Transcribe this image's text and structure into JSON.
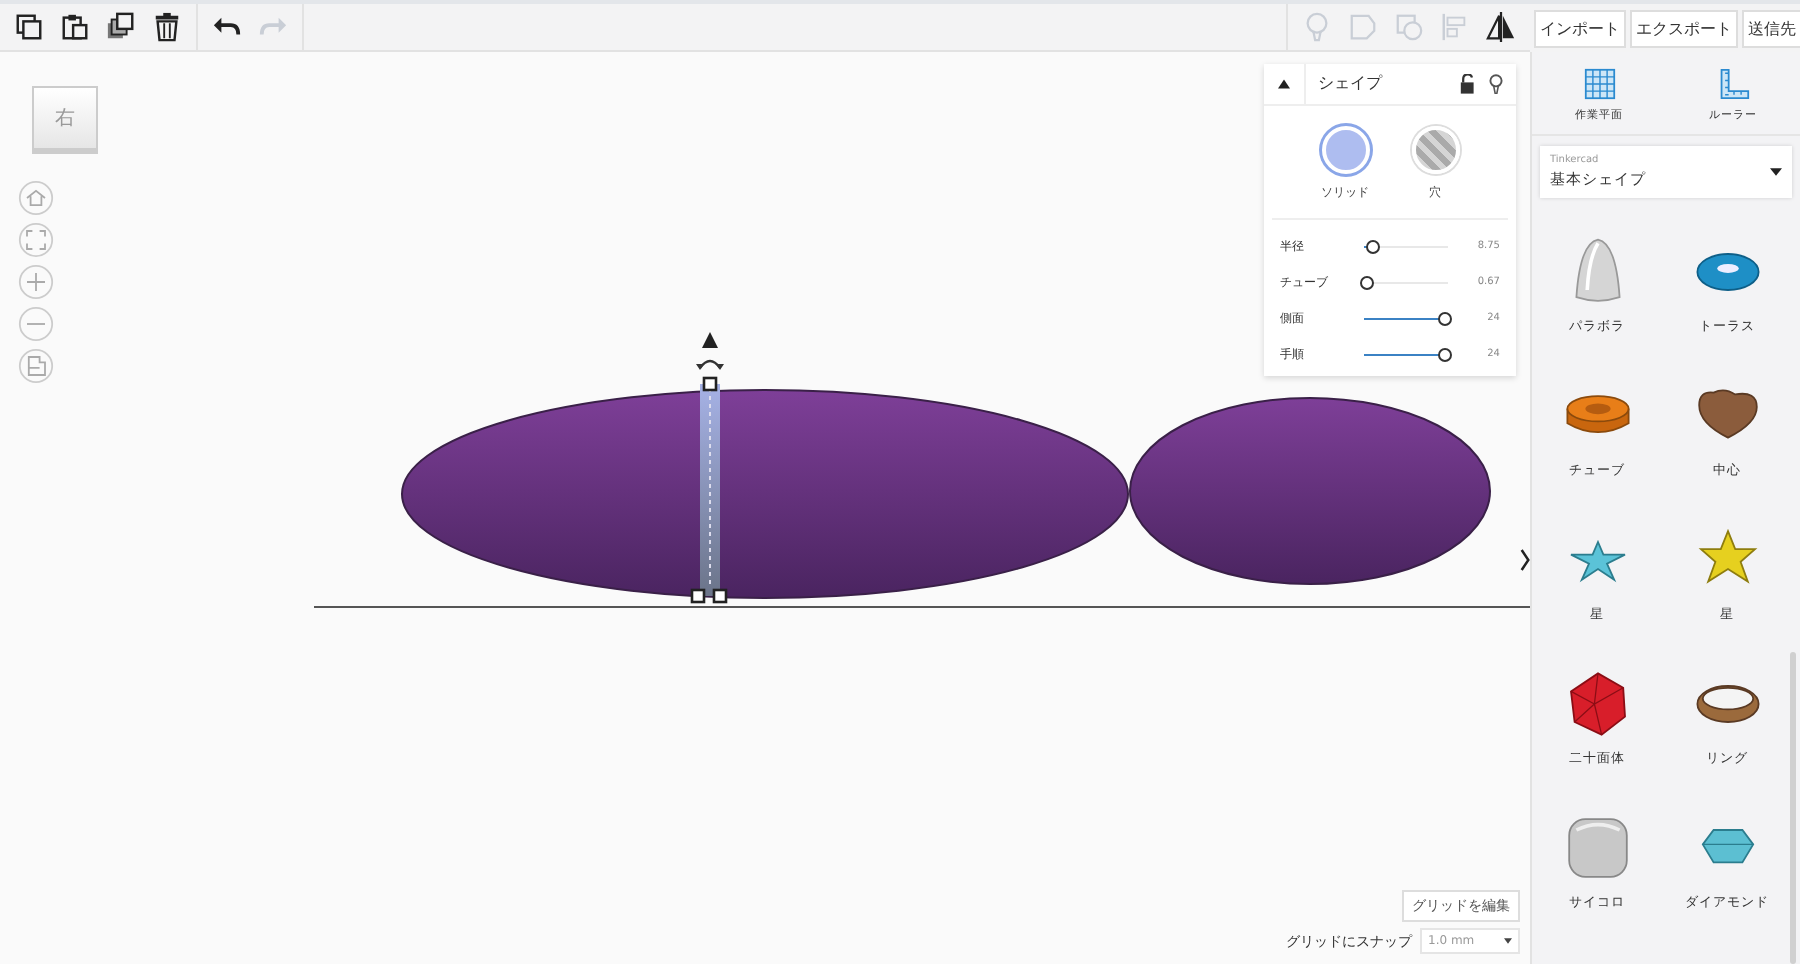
{
  "toolbar": {
    "edit_tools": [
      {
        "kind": "copy",
        "disabled": false
      },
      {
        "kind": "paste",
        "disabled": false
      },
      {
        "kind": "duplicate",
        "disabled": false
      },
      {
        "kind": "delete",
        "disabled": false
      }
    ],
    "history_tools": [
      {
        "kind": "undo",
        "disabled": false
      },
      {
        "kind": "redo",
        "disabled": true
      }
    ],
    "object_tools": [
      {
        "kind": "bulb",
        "disabled": true
      },
      {
        "kind": "group",
        "disabled": true
      },
      {
        "kind": "ungroup",
        "disabled": true
      },
      {
        "kind": "align",
        "disabled": true
      },
      {
        "kind": "mirror",
        "disabled": false
      }
    ]
  },
  "header_buttons": [
    "インポート",
    "エクスポート",
    "送信先"
  ],
  "view_cube": {
    "face": "右"
  },
  "view_controls": [
    {
      "kind": "home"
    },
    {
      "kind": "fit"
    },
    {
      "kind": "zoom-in"
    },
    {
      "kind": "zoom-out"
    },
    {
      "kind": "ortho"
    }
  ],
  "shape_panel": {
    "title": "シェイプ",
    "expanded": true,
    "modes": [
      {
        "label": "ソリッド",
        "kind": "solid",
        "selected": true
      },
      {
        "label": "穴",
        "kind": "hole",
        "selected": false
      }
    ],
    "params": [
      {
        "label": "半径",
        "level": 0.07,
        "reading": "8.75"
      },
      {
        "label": "チューブ",
        "level": 0,
        "reading": "0.67"
      },
      {
        "label": "側面",
        "level": 1,
        "reading": "24"
      },
      {
        "label": "手順",
        "level": 1,
        "reading": "24"
      }
    ]
  },
  "tools": [
    {
      "label": "作業平面",
      "kind": "workplane"
    },
    {
      "label": "ルーラー",
      "kind": "ruler"
    }
  ],
  "library": {
    "source": "Tinkercad",
    "category": "基本シェイプ"
  },
  "shapes": [
    {
      "label": "パラボラ",
      "kind": "paraboloid"
    },
    {
      "label": "トーラス",
      "kind": "torus"
    },
    {
      "label": "チューブ",
      "kind": "tube"
    },
    {
      "label": "中心",
      "kind": "heart"
    },
    {
      "label": "星",
      "kind": "star-flat"
    },
    {
      "label": "星",
      "kind": "star"
    },
    {
      "label": "二十面体",
      "kind": "icosahedron"
    },
    {
      "label": "リング",
      "kind": "ring"
    },
    {
      "label": "サイコロ",
      "kind": "dice"
    },
    {
      "label": "ダイアモンド",
      "kind": "diamond"
    }
  ],
  "grid": {
    "edit_button": "グリッドを編集",
    "snap_label": "グリッドにスナップ",
    "snap_value": "1.0 mm"
  }
}
